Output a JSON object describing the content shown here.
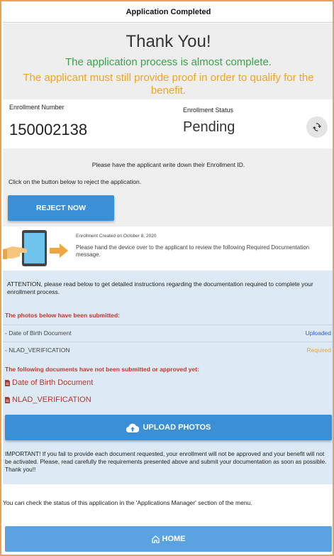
{
  "header": {
    "title": "Application Completed"
  },
  "thanks": {
    "title": "Thank You!",
    "almost_complete": "The application process is almost complete.",
    "proof_notice": "The applicant must still provide proof in order to qualify for the benefit."
  },
  "enrollment": {
    "number_label": "Enrollment Number",
    "number": "150002138",
    "status_label": "Enrollment Status",
    "status": "Pending",
    "refresh_icon": "refresh-icon"
  },
  "write_down": {
    "notice": "Please have the applicant write down their Enrollment ID.",
    "reject_hint": "Click on the button below to reject the application.",
    "reject_label": "REJECT NOW"
  },
  "device": {
    "created": "Enrollment Created on October 8, 2020",
    "message": "Please hand the device over to the applicant to review the following Required Documentation message."
  },
  "documents": {
    "attention": "ATTENTION, please read below to get detailed instructions regarding the documentation required to complete your enrollment process.",
    "submitted_heading": "The photos below have been submitted:",
    "submitted": [
      {
        "name": "- Date of Birth Document",
        "status": "Uploaded",
        "color": "#2e5fd6"
      },
      {
        "name": "- NLAD_VERIFICATION",
        "status": "Required",
        "color": "#efa61f"
      }
    ],
    "missing_heading": "The following documents have not been submitted or approved yet:",
    "missing": [
      "Date of Birth Document",
      "NLAD_VERIFICATION"
    ],
    "upload_label": "UPLOAD PHOTOS",
    "important": "IMPORTANT! If you fail to provide each document requested, your enrollment will not be approved and your benefit will not be activated. Please, read carefully the requirements presented above and submit your documentation as soon as possible. Thank you!!"
  },
  "footer": {
    "check_status": "You can check the status of this application in the 'Applications Manager' section of the menu.",
    "home_label": "HOME"
  },
  "colors": {
    "accent": "#3a8fd6",
    "success": "#38a34a",
    "warning": "#efa61f",
    "danger": "#c0392b"
  }
}
